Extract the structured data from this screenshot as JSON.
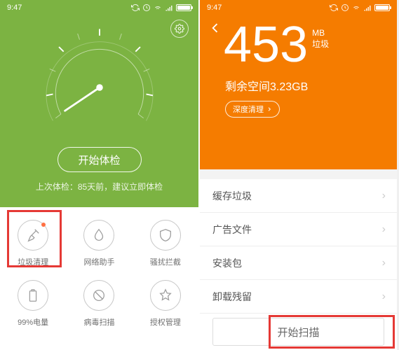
{
  "status": {
    "time": "9:47"
  },
  "left": {
    "start_button": "开始体检",
    "last_check": "上次体检：85天前，建议立即体检",
    "grid": [
      {
        "label": "垃圾清理"
      },
      {
        "label": "网络助手"
      },
      {
        "label": "骚扰拦截"
      },
      {
        "label": "99%电量"
      },
      {
        "label": "病毒扫描"
      },
      {
        "label": "授权管理"
      }
    ]
  },
  "right": {
    "size_value": "453",
    "size_unit": "MB",
    "size_caption": "垃圾",
    "space_left_prefix": "剩余空间",
    "space_left_value": "3.23GB",
    "deep_clean": "深度清理",
    "list": [
      {
        "label": "缓存垃圾"
      },
      {
        "label": "广告文件"
      },
      {
        "label": "安装包"
      },
      {
        "label": "卸载残留"
      }
    ],
    "scan_button": "开始扫描"
  }
}
